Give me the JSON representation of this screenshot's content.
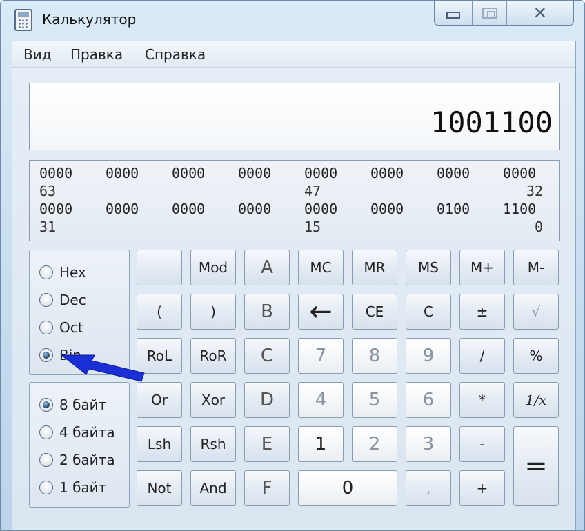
{
  "window": {
    "title": "Калькулятор"
  },
  "menu": [
    "Вид",
    "Правка",
    "Справка"
  ],
  "display": {
    "value": "1001100"
  },
  "bits": {
    "row1": [
      "0000",
      "0000",
      "0000",
      "0000",
      "0000",
      "0000",
      "0000",
      "0000"
    ],
    "row1_positions": [
      "63",
      "47",
      "32"
    ],
    "row2": [
      "0000",
      "0000",
      "0000",
      "0000",
      "0000",
      "0000",
      "0100",
      "1100"
    ],
    "row2_positions": [
      "31",
      "15",
      "0"
    ]
  },
  "radix": {
    "options": [
      "Hex",
      "Dec",
      "Oct",
      "Bin"
    ],
    "selected": "Bin"
  },
  "word_size": {
    "options": [
      "8 байт",
      "4 байта",
      "2 байта",
      "1 байт"
    ],
    "selected": "8 байт"
  },
  "buttons": [
    [
      "",
      "Mod",
      "A",
      "MC",
      "MR",
      "MS",
      "M+",
      "M-"
    ],
    [
      "(",
      ")",
      "B",
      "←",
      "CE",
      "C",
      "±",
      "√"
    ],
    [
      "RoL",
      "RoR",
      "C",
      "7",
      "8",
      "9",
      "/",
      "%"
    ],
    [
      "Or",
      "Xor",
      "D",
      "4",
      "5",
      "6",
      "*",
      "1/x"
    ],
    [
      "Lsh",
      "Rsh",
      "E",
      "1",
      "2",
      "3",
      "-",
      "="
    ],
    [
      "Not",
      "And",
      "F",
      "0",
      "",
      ",",
      "+",
      ""
    ]
  ],
  "colors": {
    "arrow": "#1a2fd6"
  }
}
